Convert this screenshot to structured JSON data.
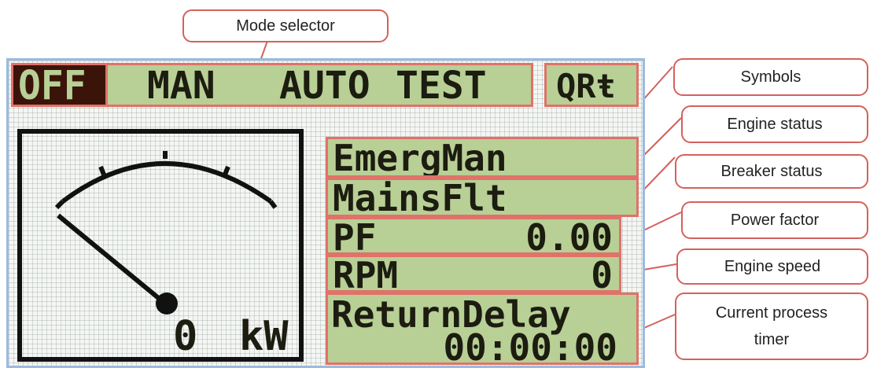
{
  "mode_selector": {
    "modes": [
      "OFF",
      "MAN",
      "AUTO",
      "TEST"
    ],
    "selected": "OFF",
    "symbols": "QRŧ"
  },
  "gauge": {
    "value": "0",
    "unit": "kW"
  },
  "status": {
    "engine_status": "EmergMan",
    "breaker_status": "MainsFlt",
    "power_factor_label": "PF",
    "power_factor_value": "0.00",
    "rpm_label": "RPM",
    "rpm_value": "0",
    "timer_label": "ReturnDelay",
    "timer_value": "00:00:00"
  },
  "callouts": {
    "mode_selector": "Mode selector",
    "symbols": "Symbols",
    "engine_status": "Engine status",
    "breaker_status": "Breaker status",
    "power_factor": "Power factor",
    "engine_speed": "Engine speed",
    "process_timer_line1": "Current process",
    "process_timer_line2": "timer"
  },
  "colors": {
    "highlight_fill": "#b8cf96",
    "highlight_border": "#e0726a",
    "lcd_ink": "#1c1c10",
    "selected_mode_bg": "#3a1408",
    "callout_border": "#d4615c",
    "panel_border": "#9bbbe0"
  }
}
